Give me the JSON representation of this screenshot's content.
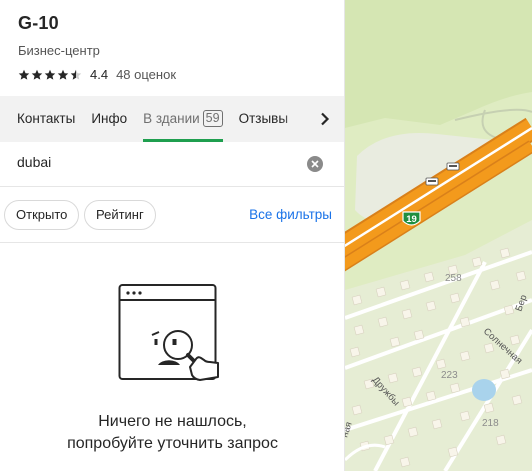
{
  "place": {
    "title": "G-10",
    "subtitle": "Бизнес-центр",
    "rating_value": "4.4",
    "rating_stars": 4.5,
    "rating_count": "48 оценок"
  },
  "tabs": [
    {
      "label": "Контакты"
    },
    {
      "label": "Инфо"
    },
    {
      "label": "В здании",
      "badge": "59",
      "active": true
    },
    {
      "label": "Отзывы"
    }
  ],
  "search": {
    "value": "dubai"
  },
  "filters": {
    "chips": [
      "Открыто",
      "Рейтинг"
    ],
    "all_label": "Все фильтры"
  },
  "empty": {
    "line1": "Ничего не нашлось,",
    "line2": "попробуйте уточнить запрос"
  },
  "map": {
    "road_label": "19",
    "house_numbers": [
      "258",
      "223",
      "218"
    ],
    "street_labels": [
      "Солнечная",
      "Дружбы",
      "Бер",
      "ная"
    ]
  },
  "colors": {
    "accent": "#1f9f4f",
    "link": "#1a73e8",
    "map_background": "#dfecc2",
    "road": "#f39a1c"
  }
}
